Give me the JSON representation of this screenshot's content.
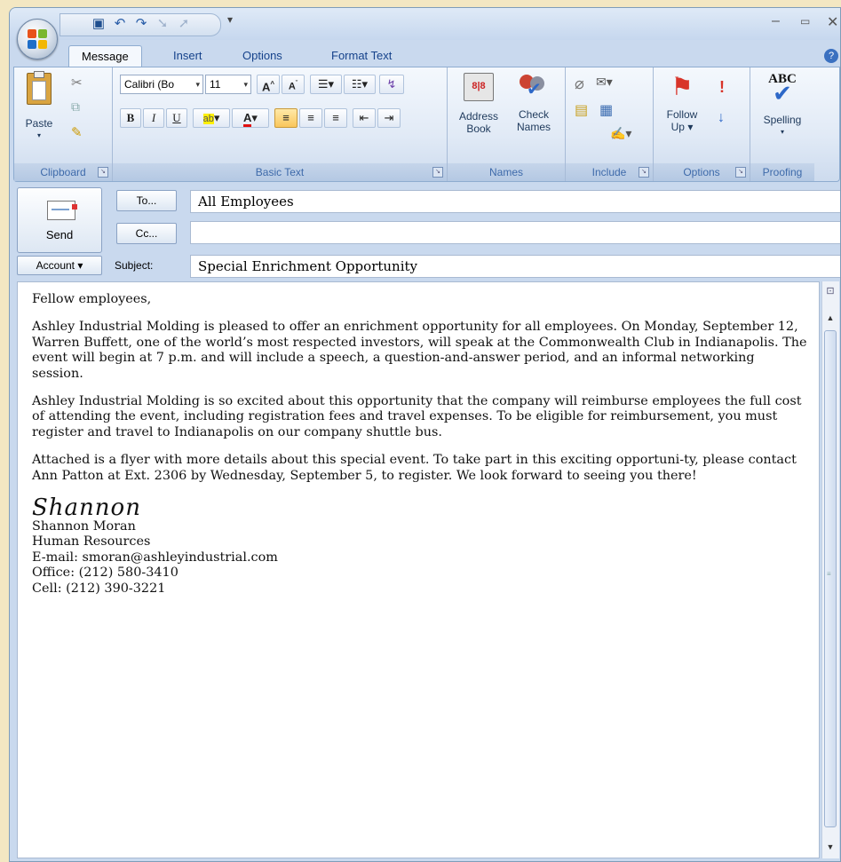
{
  "quick_access": {
    "icons": [
      "save-icon",
      "undo-icon",
      "redo-icon",
      "previous-icon",
      "next-icon",
      "customize-icon"
    ]
  },
  "tabs": [
    {
      "label": "Message",
      "active": true
    },
    {
      "label": "Insert"
    },
    {
      "label": "Options"
    },
    {
      "label": "Format Text"
    }
  ],
  "ribbon": {
    "clipboard": {
      "paste": "Paste",
      "group": "Clipboard"
    },
    "basic_text": {
      "font_name": "Calibri (Bo",
      "font_size": "11",
      "bold": "B",
      "italic": "I",
      "underline": "U",
      "group": "Basic Text"
    },
    "names": {
      "address_line1": "Address",
      "address_line2": "Book",
      "check_line1": "Check",
      "check_line2": "Names",
      "group": "Names"
    },
    "include": {
      "group": "Include"
    },
    "options": {
      "follow_line1": "Follow",
      "follow_line2": "Up",
      "group": "Options"
    },
    "proofing": {
      "spelling_icon_text": "ABC",
      "spelling": "Spelling",
      "group": "Proofing"
    }
  },
  "header": {
    "send": "Send",
    "to_button": "To...",
    "cc_button": "Cc...",
    "account_button": "Account",
    "subject_label": "Subject:",
    "to_value": "All Employees",
    "cc_value": "",
    "subject_value": "Special Enrichment Opportunity"
  },
  "message": {
    "greeting": "Fellow employees,",
    "para1": "Ashley Industrial Molding is pleased to offer an enrichment opportunity for all employees. On Monday, September 12, Warren Buffett, one of the world’s most respected investors, will speak at the Commonwealth Club in Indianapolis. The event will begin at 7 p.m. and will include a speech, a question-and-answer period, and an informal networking session.",
    "para2": "Ashley Industrial Molding is so excited about this opportunity that the company will reimburse employees the full cost of attending the event, including registration fees and travel expenses. To be eligible for reimbursement, you must register and travel to Indianapolis on our company shuttle bus.",
    "para3": "Attached is a flyer with more details about this special event. To take part in this exciting opportuni-ty, please contact Ann Patton at Ext. 2306 by Wednesday, September 5, to register. We look forward to seeing you there!",
    "signature_script": "Shannon",
    "sig_name": "Shannon Moran",
    "sig_dept": "Human Resources",
    "sig_email": "E-mail: smoran@ashleyindustrial.com",
    "sig_office": "Office: (212) 580-3410",
    "sig_cell": "Cell: (212) 390-3221"
  }
}
